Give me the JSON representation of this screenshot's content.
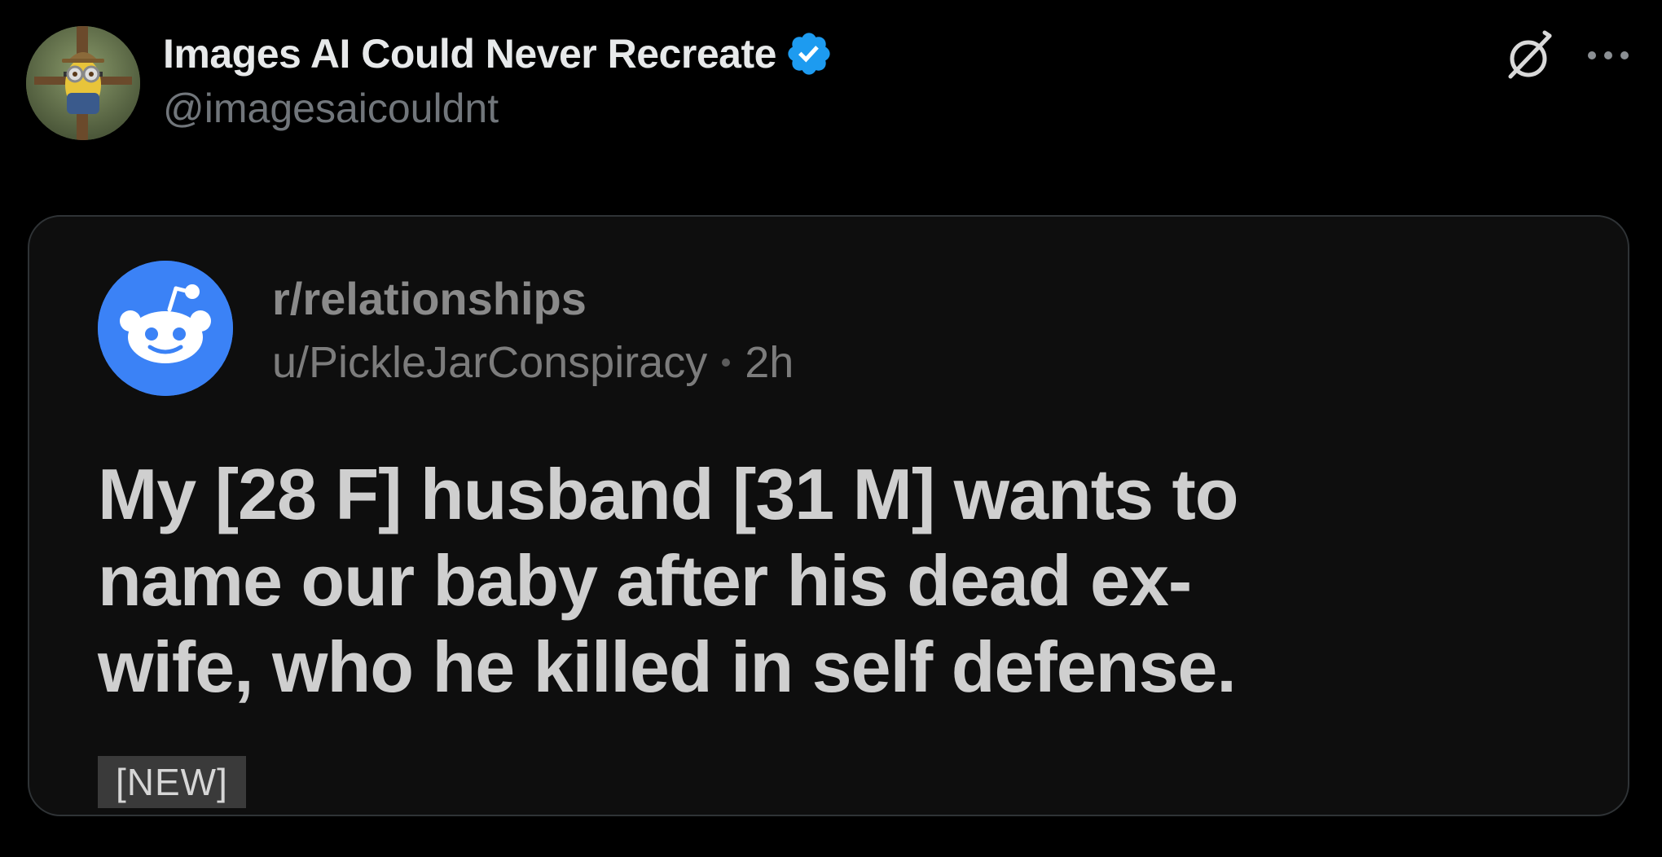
{
  "tweet": {
    "author": {
      "display_name": "Images AI Could Never Recreate",
      "handle": "@imagesaicouldnt",
      "verified": true,
      "avatar": "avatar-minion-scarecrow",
      "verified_badge_icon": "verified-badge-icon",
      "verified_color": "#1d9bf0"
    },
    "actions": {
      "grok_icon": "grok-icon",
      "more_icon": "more-dots-icon"
    }
  },
  "media": {
    "reddit_post": {
      "logo_icon": "reddit-snoo-icon",
      "logo_color": "#3b82f6",
      "subreddit": "r/relationships",
      "user": "u/PickleJarConspiracy",
      "time": "2h",
      "title": "My [28 F] husband [31 M] wants to\nname our baby after his dead ex-\nwife, who he killed in self defense.",
      "tag": "[NEW]"
    }
  },
  "colors": {
    "background": "#000000",
    "card_background": "#0e0e0e",
    "card_border": "#2f3336",
    "text_primary": "#e7e9ea",
    "text_secondary": "#71767b"
  }
}
